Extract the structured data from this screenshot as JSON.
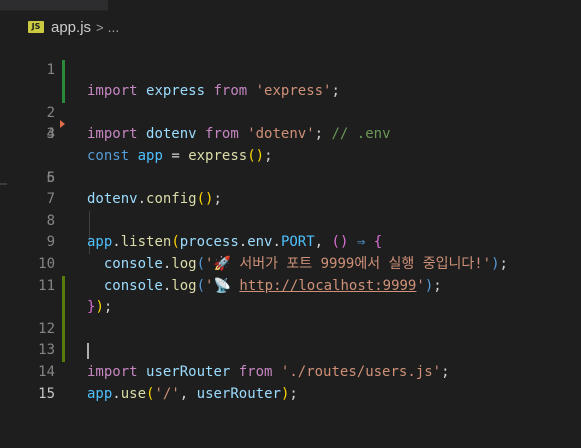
{
  "breadcrumb": {
    "file_icon_label": "JS",
    "file_name": "app.js",
    "separator": ">",
    "more": "..."
  },
  "editor": {
    "language": "javascript",
    "active_line": 15,
    "lines": [
      {
        "n": "1",
        "git": "none"
      },
      {
        "n": "2",
        "git": "modified"
      },
      {
        "n": "3",
        "git": "modified"
      },
      {
        "n": "4",
        "git": "none"
      },
      {
        "n": "5",
        "git": "deleted"
      },
      {
        "n": "6",
        "git": "none"
      },
      {
        "n": "7",
        "git": "none"
      },
      {
        "n": "8",
        "git": "none"
      },
      {
        "n": "9",
        "git": "none"
      },
      {
        "n": "10",
        "git": "none"
      },
      {
        "n": "11",
        "git": "none"
      },
      {
        "n": "12",
        "git": "added"
      },
      {
        "n": "13",
        "git": "added"
      },
      {
        "n": "14",
        "git": "added"
      },
      {
        "n": "15",
        "git": "added"
      }
    ],
    "tokens": {
      "l1": {
        "import": "import",
        "express": "express",
        "from": "from",
        "str": "'express'",
        "semi": ";"
      },
      "l2": {
        "import": "import",
        "dotenv": "dotenv",
        "from": "from",
        "str": "'dotenv'",
        "semi": ";",
        "comment": "// .env"
      },
      "l4": {
        "const": "const",
        "app": "app",
        "eq": "=",
        "express": "express",
        "open": "(",
        "close": ")",
        "semi": ";"
      },
      "l6": {
        "dotenv": "dotenv",
        "dot": ".",
        "config": "config",
        "open": "(",
        "close": ")",
        "semi": ";"
      },
      "l8": {
        "app": "app",
        "dot1": ".",
        "listen": "listen",
        "open": "(",
        "process": "process",
        "dot2": ".",
        "env": "env",
        "dot3": ".",
        "port": "PORT",
        "comma": ",",
        "args": "()",
        "arrow": "⇒",
        "brace": "{"
      },
      "l9": {
        "console": "console",
        "dot": ".",
        "log": "log",
        "open": "(",
        "q1": "'",
        "emoji": "🚀",
        "text": " 서버가 포트 9999에서 실행 중입니다!",
        "q2": "'",
        "close": ")",
        "semi": ";"
      },
      "l10": {
        "console": "console",
        "dot": ".",
        "log": "log",
        "open": "(",
        "q1": "'",
        "emoji": "📡",
        "url": "http://localhost:9999",
        "q2": "'",
        "close": ")",
        "semi": ";"
      },
      "l11": {
        "brace": "}",
        "close": ")",
        "semi": ";"
      },
      "l13": {
        "import": "import",
        "userRouter": "userRouter",
        "from": "from",
        "str": "'./routes/users.js'",
        "semi": ";"
      },
      "l14": {
        "app": "app",
        "dot": ".",
        "use": "use",
        "open": "(",
        "str": "'/'",
        "comma": ",",
        "userRouter": "userRouter",
        "close": ")",
        "semi": ";"
      }
    }
  }
}
